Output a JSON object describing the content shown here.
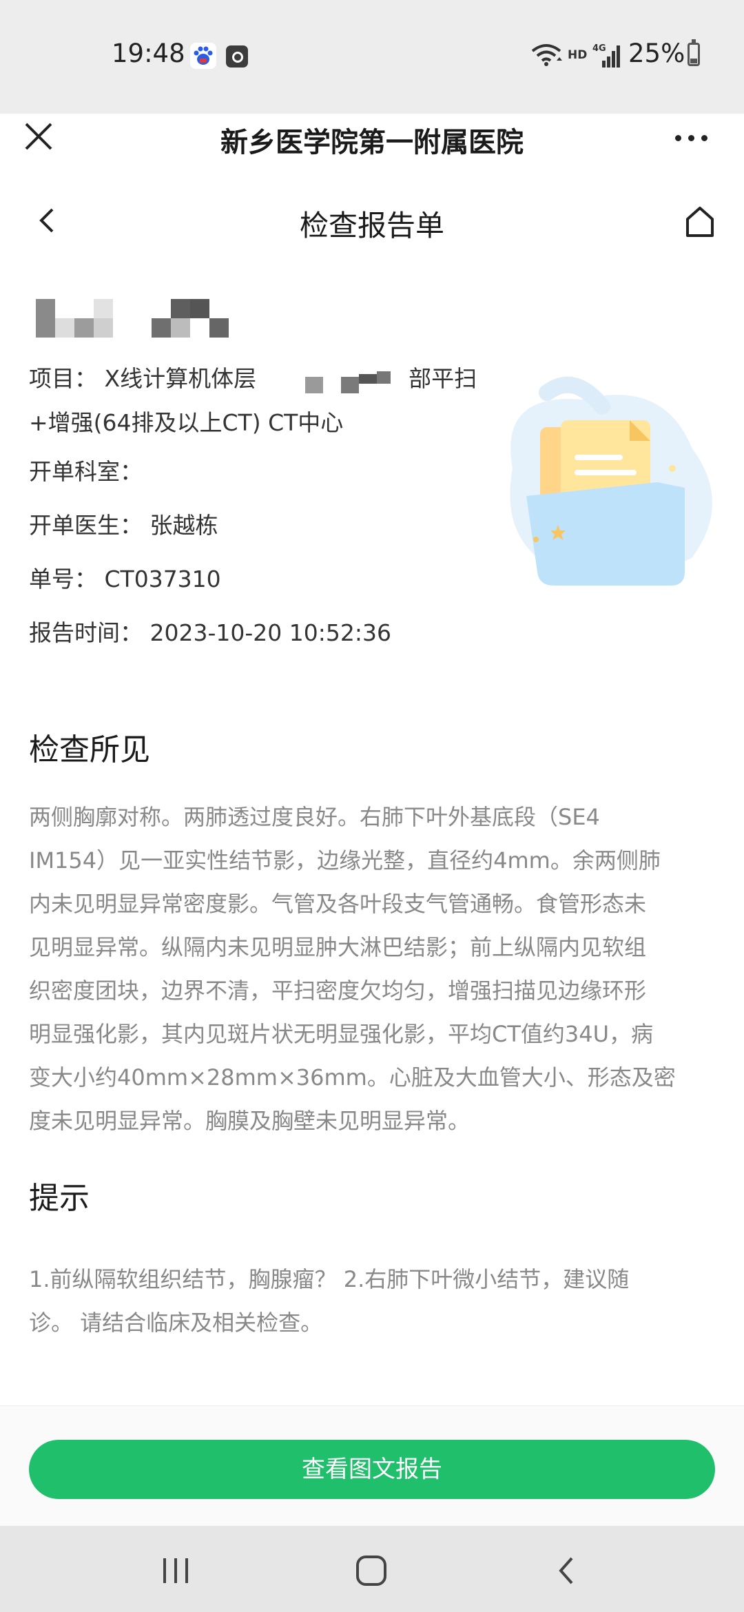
{
  "status_bar": {
    "time": "19:48",
    "network_label": "HD",
    "battery": "25%"
  },
  "app_bar": {
    "title": "新乡医学院第一附属医院"
  },
  "page": {
    "title": "检查报告单"
  },
  "report": {
    "patient_name": "",
    "item_label": "项目：",
    "item_value_line1": "X线计算机体层",
    "item_value_line1_end": "部平扫",
    "item_value_line2": "+增强(64排及以上CT) CT中心",
    "department_label": "开单科室：",
    "department_value": "",
    "doctor_label": "开单医生：",
    "doctor_value": "张越栋",
    "order_label": "单号：",
    "order_value": "CT037310",
    "time_label": "报告时间：",
    "time_value": "2023-10-20 10:52:36"
  },
  "findings": {
    "heading": "检查所见",
    "lines": [
      "两侧胸廓对称。两肺透过度良好。右肺下叶外基底段（SE4",
      "IM154）见一亚实性结节影，边缘光整，直径约4mm。余两侧肺",
      "内未见明显异常密度影。气管及各叶段支气管通畅。食管形态未",
      "见明显异常。纵隔内未见明显肿大淋巴结影；前上纵隔内见软组",
      "织密度团块，边界不清，平扫密度欠均匀，增强扫描见边缘环形",
      "明显强化影，其内见斑片状无明显强化影，平均CT值约34U，病",
      "变大小约40mm×28mm×36mm。心脏及大血管大小、形态及密",
      "度未见明显异常。胸膜及胸壁未见明显异常。"
    ]
  },
  "tips": {
    "heading": "提示",
    "lines": [
      "1.前纵隔软组织结节，胸腺瘤？ 2.右肺下叶微小结节，建议随",
      "诊。 请结合临床及相关检查。"
    ]
  },
  "actions": {
    "view_report_button": "查看图文报告"
  },
  "colors": {
    "accent": "#20bf6b",
    "status_bar_bg": "#ededed",
    "muted_text": "#888888"
  },
  "icons": {
    "close": "close-icon",
    "more": "more-icon",
    "back": "chevron-left-icon",
    "home": "home-icon",
    "recents": "recents-icon",
    "home_nav": "home-nav-icon",
    "back_nav": "back-nav-icon"
  }
}
